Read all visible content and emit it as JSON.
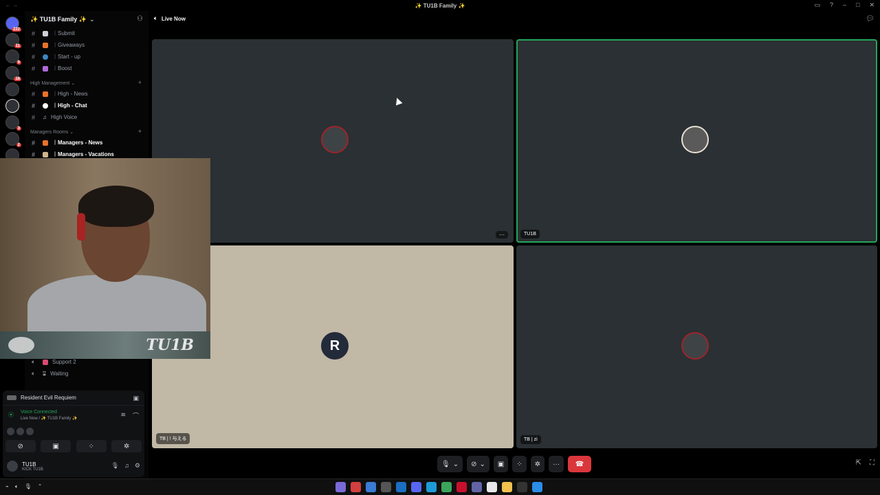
{
  "window": {
    "title": "✨ TU1B Family ✨"
  },
  "rail": {
    "badges": [
      "222",
      "11",
      "9",
      "18",
      "3",
      "2"
    ]
  },
  "guild": {
    "name": "✨ TU1B Family ✨"
  },
  "channels": {
    "top": [
      {
        "label": "︱Submit"
      },
      {
        "label": "︱Giveaways"
      },
      {
        "label": "︱Start - up"
      },
      {
        "label": "︱Boost"
      }
    ],
    "cat_high": "High Management",
    "high": [
      {
        "label": "︱High - News"
      },
      {
        "label": "︱High - Chat"
      },
      {
        "label": "High Voice"
      }
    ],
    "cat_managers": "Managers Rooms",
    "managers": [
      {
        "label": "︱Managers - News"
      },
      {
        "label": "︱Managers - Vacations"
      }
    ],
    "lower": [
      {
        "label": "Support 2"
      },
      {
        "label": "Waiting"
      }
    ]
  },
  "voice": {
    "activity": "Resident Evil Requiem",
    "status": "Voice Connected",
    "location": "Live Now / ✨ TU1B Family ✨"
  },
  "user": {
    "name": "TU1B",
    "status": "KICK TU1B"
  },
  "call": {
    "channel": "Live Now",
    "tiles": [
      {
        "tag": ""
      },
      {
        "tag": "TU1B"
      },
      {
        "tag": "TB | ! 与える"
      },
      {
        "tag": "TB | zi"
      }
    ],
    "more_label": "···"
  },
  "webcam": {
    "banner_text": "TU1B"
  },
  "colors": {
    "speaking": "#23a55a",
    "end_call": "#da373c",
    "beige_tile": "#c1b8a6"
  }
}
